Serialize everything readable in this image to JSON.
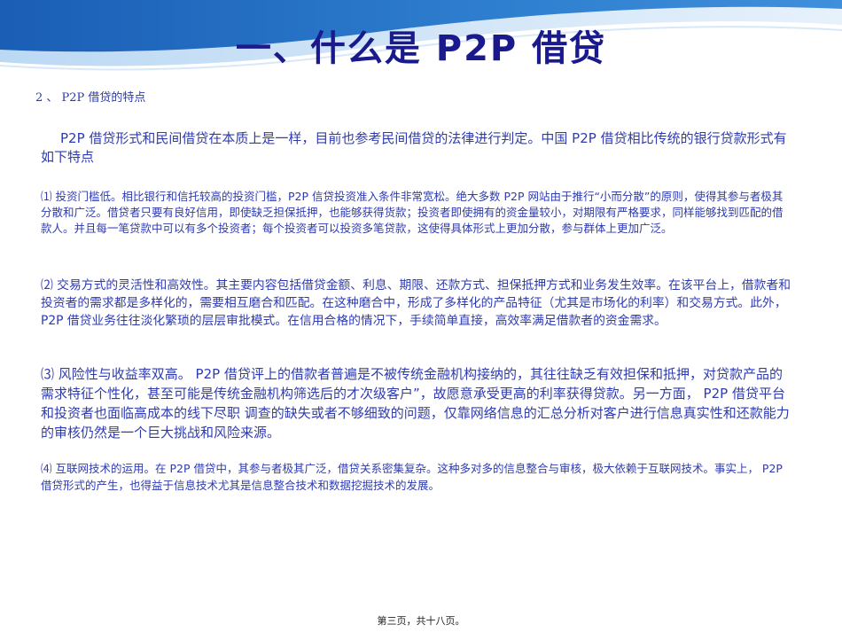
{
  "slide": {
    "title": "一、什么是 P2P 借贷",
    "subtitle": "2 、 P2P 借贷的特点",
    "intro": "P2P 借贷形式和民间借贷在本质上是一样，目前也参考民间借贷的法律进行判定。中国 P2P 借贷相比传统的银行贷款形式有如下特点",
    "points": [
      "⑴ 投资门槛低。相比银行和信托较高的投资门槛，P2P 信贷投资准入条件非常宽松。绝大多数 P2P 网站由于推行“小而分散”的原则，使得其参与者极其分散和广泛。借贷者只要有良好信用，即使缺乏担保抵押，也能够获得货款；投资者即使拥有的资金量较小，对期限有严格要求，同样能够找到匹配的借款人。并且每一笔贷款中可以有多个投资者；每个投资者可以投资多笔贷款，这使得具体形式上更加分散，参与群体上更加广泛。",
      "⑵ 交易方式的灵活性和高效性。其主要内容包括借贷金额、利息、期限、还款方式、担保抵押方式和业务发生效率。在该平台上，借款者和投资者的需求都是多样化的，需要相互磨合和匹配。在这种磨合中，形成了多样化的产品特征（尤其是市场化的利率）和交易方式。此外， P2P 借贷业务往往淡化繁琐的层层审批模式。在信用合格的情况下，手续简单直接，高效率满足借款者的资金需求。",
      "⑶ 风险性与收益率双高。 P2P 借贷评上的借款者普遍是不被传统金融机构接纳的，其往往缺乏有效担保和抵押，对贷款产品的需求特征个性化，甚至可能是传统金融机构筛选后的才次级客户”，故愿意承受更高的利率获得贷款。另一方面， P2P 借贷平台和投资者也面临高成本的线下尽职 调查的缺失或者不够细致的问题，仅靠网络信息的汇总分析对客户进行信息真实性和还款能力的审核仍然是一个巨大挑战和风险来源。",
      "⑷ 互联网技术的运用。在 P2P 借贷中，其参与者极其广泛，借贷关系密集复杂。这种多对多的信息整合与审核，极大依赖于互联网技术。事实上， P2P 借贷形式的产生，也得益于信息技术尤其是信息整合技术和数据挖掘技术的发展。"
    ],
    "footer": "第三页，共十八页。"
  },
  "colors": {
    "title": "#1a1a8c",
    "body": "#2e3bb0",
    "swoosh_dark": "#1e63b8",
    "swoosh_light": "#9cc6ec"
  }
}
